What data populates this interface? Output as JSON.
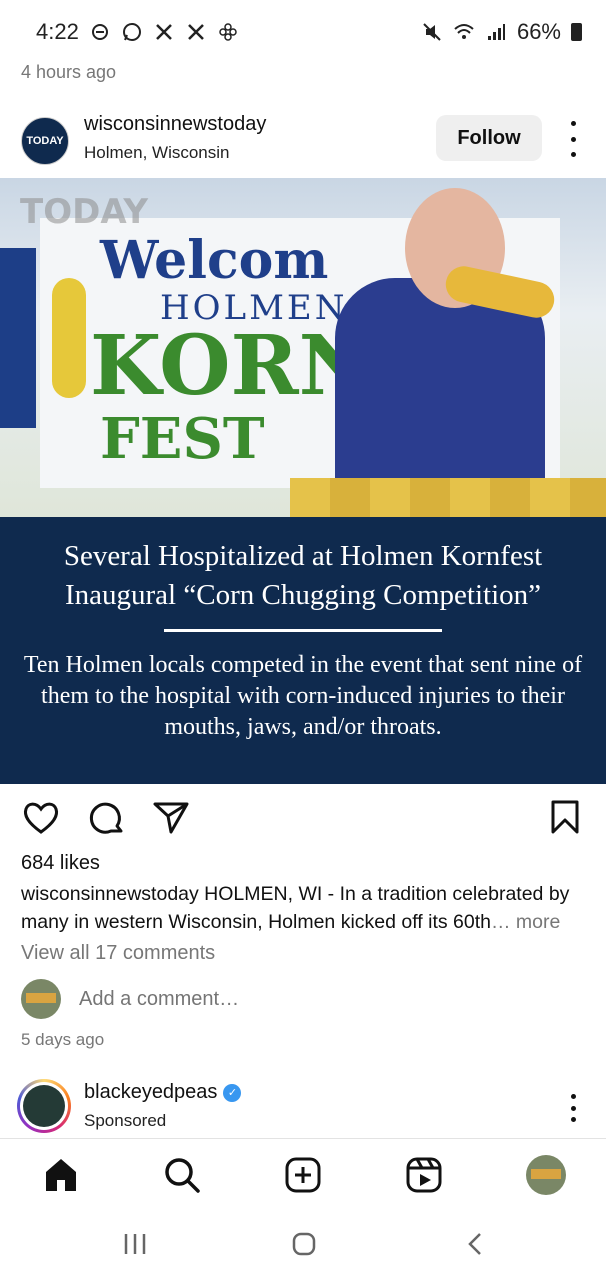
{
  "status_bar": {
    "time": "4:22",
    "battery": "66%",
    "left_icons": [
      "do-not-disturb-icon",
      "whatsapp-icon",
      "x-icon",
      "x-icon",
      "pinwheel-icon"
    ],
    "right_icons": [
      "mute-icon",
      "wifi-icon",
      "signal-icon",
      "battery-icon"
    ]
  },
  "feed": {
    "prev_post_time": "4 hours ago"
  },
  "post": {
    "username": "wisconsinnewstoday",
    "location": "Holmen, Wisconsin",
    "follow_label": "Follow",
    "avatar_text": "TODAY",
    "image": {
      "watermark": "TODAY",
      "banner_welcome": "Welcom",
      "banner_holmen": "HOLMEN",
      "banner_korn": "KORN",
      "banner_fest": "FEST",
      "headline": "Several Hospitalized at Holmen Kornfest Inaugural “Corn Chugging Competition”",
      "subhead": "Ten Holmen locals competed in the event that sent nine of them to the hospital with corn-induced injuries to their mouths, jaws, and/or throats.",
      "panel_color": "#0f2a4e"
    },
    "likes": "684 likes",
    "caption_user": "wisconsinnewstoday",
    "caption_text": " HOLMEN, WI - In a tradition celebrated by many in western Wisconsin, Holmen kicked off its 60th",
    "caption_more": "… more",
    "view_comments": "View all 17 comments",
    "add_comment_placeholder": "Add a comment…",
    "time_ago": "5 days ago"
  },
  "next_post": {
    "username": "blackeyedpeas",
    "label": "Sponsored"
  },
  "nav": {
    "items": [
      "home-icon",
      "search-icon",
      "create-icon",
      "reels-icon",
      "profile-avatar"
    ]
  },
  "colors": {
    "verified": "#3897f0",
    "muted_text": "#777777"
  }
}
